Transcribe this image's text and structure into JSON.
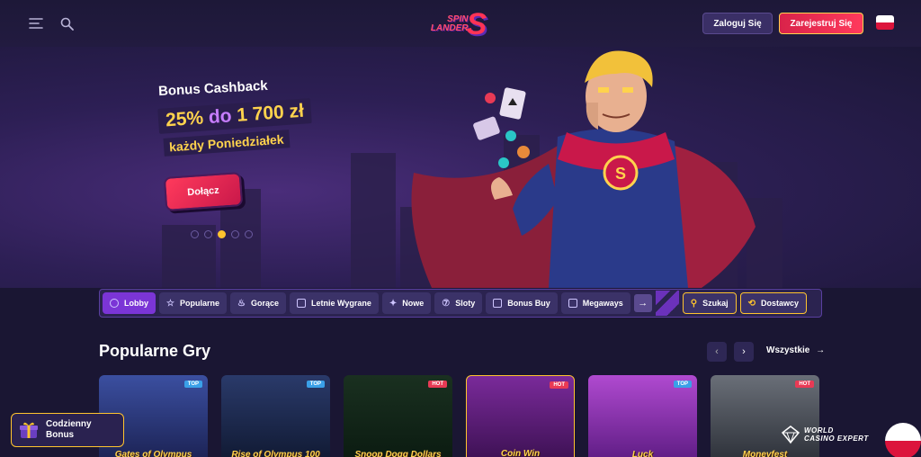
{
  "header": {
    "logo_top": "SPIN",
    "logo_bottom": "LANDER",
    "logo_mark": "S",
    "login_label": "Zaloguj Się",
    "register_label": "Zarejestruj Się",
    "icons": [
      "menu-icon",
      "search-icon",
      "poland-flag-icon"
    ]
  },
  "hero": {
    "subtitle": "Bonus Cashback",
    "amount_a": "25%",
    "amount_mid": "do",
    "amount_b": "1 700 zł",
    "line2": "każdy Poniedziałek",
    "cta_label": "Dołącz",
    "active_slide": 1,
    "slides": 5
  },
  "categories": [
    {
      "label": "Lobby",
      "active": true,
      "icon": "lobby-icon"
    },
    {
      "label": "Popularne",
      "active": false,
      "icon": "star-icon"
    },
    {
      "label": "Gorące",
      "active": false,
      "icon": "fire-icon"
    },
    {
      "label": "Letnie Wygrane",
      "active": false,
      "icon": "sun-icon"
    },
    {
      "label": "Nowe",
      "active": false,
      "icon": "new-icon"
    },
    {
      "label": "Sloty",
      "active": false,
      "icon": "slot-icon"
    },
    {
      "label": "Bonus Buy",
      "active": false,
      "icon": "bonus-buy-icon"
    },
    {
      "label": "Megaways",
      "active": false,
      "icon": "megaways-icon"
    }
  ],
  "tools": {
    "search_label": "Szukaj",
    "providers_label": "Dostawcy"
  },
  "section": {
    "title": "Popularne Gry",
    "see_all": "Wszystkie"
  },
  "games": [
    {
      "name": "Gates of Olympus",
      "badge": "TOP",
      "bg1": "#3b4fa0",
      "bg2": "#1a2050"
    },
    {
      "name": "Rise of Olympus 100",
      "badge": "TOP",
      "bg1": "#2a3a6a",
      "bg2": "#0f1830"
    },
    {
      "name": "Snoop Dogg Dollars",
      "badge": "HOT",
      "bg1": "#1a3020",
      "bg2": "#0a1a10"
    },
    {
      "name": "Coin Win",
      "badge": "HOT",
      "bg1": "#7a2a9a",
      "bg2": "#3a1050"
    },
    {
      "name": "Luck",
      "badge": "TOP",
      "bg1": "#b04ad0",
      "bg2": "#5a1a80"
    },
    {
      "name": "Moneyfest",
      "badge": "HOT",
      "bg1": "#6a6f78",
      "bg2": "#2a2e36"
    }
  ],
  "daily": {
    "line1": "Codzienny",
    "line2": "Bonus"
  },
  "watermark": {
    "line1": "WORLD",
    "line2": "CASINO EXPERT"
  },
  "colors": {
    "accent": "#7b35d6",
    "gold": "#ffc42e",
    "red": "#ff3a5c"
  }
}
